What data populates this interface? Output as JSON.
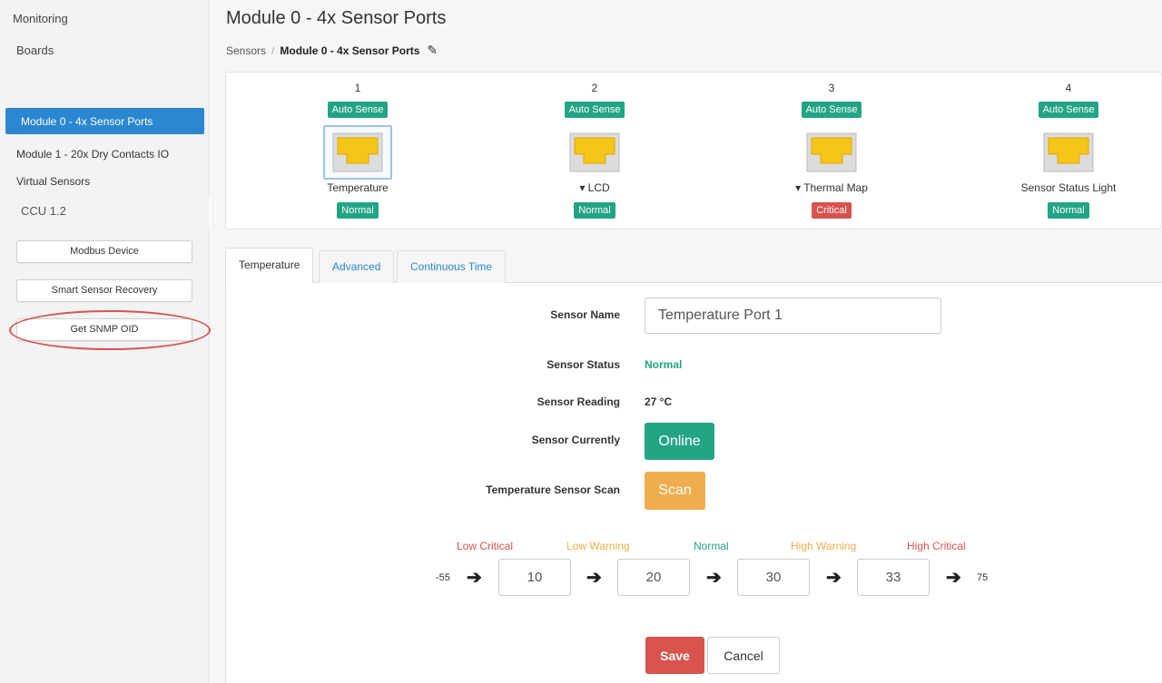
{
  "sidebar": {
    "monitoring": "Monitoring",
    "boards": "Boards",
    "active_item": "Module 0 - 4x Sensor Ports",
    "module1": "Module 1 - 20x Dry Contacts IO",
    "virtual": "Virtual Sensors",
    "ccu": "CCU 1.2",
    "buttons": [
      "Modbus Device",
      "Smart Sensor Recovery",
      "Get SNMP OID"
    ]
  },
  "page": {
    "title": "Module 0 - 4x Sensor Ports",
    "breadcrumb_root": "Sensors",
    "breadcrumb_sep": "/",
    "breadcrumb_current": "Module 0 - 4x Sensor Ports",
    "edit_icon": "✎"
  },
  "ports": [
    {
      "num": "1",
      "mode": "Auto Sense",
      "label": "Temperature",
      "status": "Normal",
      "status_color": "#23a584"
    },
    {
      "num": "2",
      "mode": "Auto Sense",
      "label": "▾ LCD",
      "status": "Normal",
      "status_color": "#23a584"
    },
    {
      "num": "3",
      "mode": "Auto Sense",
      "label": "▾ Thermal Map",
      "status": "Critical",
      "status_color": "#d9534f"
    },
    {
      "num": "4",
      "mode": "Auto Sense",
      "label": "Sensor Status Light",
      "status": "Normal",
      "status_color": "#23a584"
    }
  ],
  "tabs": [
    "Temperature",
    "Advanced",
    "Continuous Time"
  ],
  "form": {
    "name_label": "Sensor Name",
    "name_value": "Temperature Port 1",
    "status_label": "Sensor Status",
    "status_value": "Normal",
    "reading_label": "Sensor Reading",
    "reading_value": "27 °C",
    "currently_label": "Sensor Currently",
    "currently_button": "Online",
    "scan_label": "Temperature Sensor Scan",
    "scan_button": "Scan"
  },
  "thresholds": {
    "labels": [
      "Low Critical",
      "Low Warning",
      "Normal",
      "High Warning",
      "High Critical"
    ],
    "label_colors": [
      "#d9534f",
      "#f0ad4e",
      "#23a584",
      "#f0ad4e",
      "#d9534f"
    ],
    "min": "-55",
    "max": "75",
    "values": [
      "10",
      "20",
      "30",
      "33"
    ],
    "arrow": "➔"
  },
  "actions": {
    "save": "Save",
    "cancel": "Cancel"
  },
  "colors": {
    "accent": "#2a87d0",
    "success": "#23a584",
    "danger": "#d9534f",
    "warning": "#f0ad4e"
  }
}
